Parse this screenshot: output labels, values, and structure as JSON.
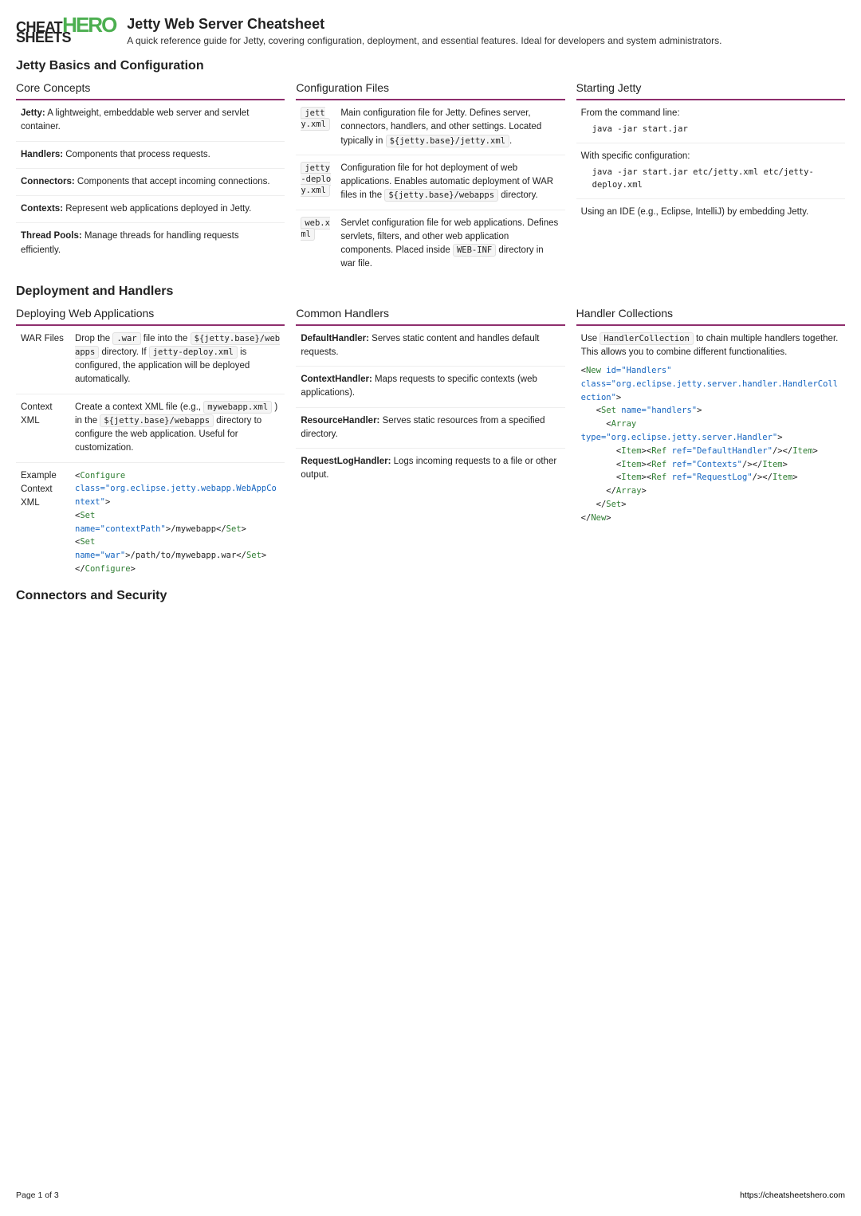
{
  "logo": {
    "line1": "CHEAT",
    "line2": "SHEETS",
    "hero": "HERO"
  },
  "title": "Jetty Web Server Cheatsheet",
  "subtitle": "A quick reference guide for Jetty, covering configuration, deployment, and essential features. Ideal for developers and system administrators.",
  "s1": {
    "heading": "Jetty Basics and Configuration",
    "core": {
      "title": "Core Concepts",
      "r1b": "Jetty:",
      "r1": " A lightweight, embeddable web server and servlet container.",
      "r2b": "Handlers:",
      "r2": " Components that process requests.",
      "r3b": "Connectors:",
      "r3": " Components that accept incoming connections.",
      "r4b": "Contexts:",
      "r4": " Represent web applications deployed in Jetty.",
      "r5b": "Thread Pools:",
      "r5": " Manage threads for handling requests efficiently."
    },
    "config": {
      "title": "Configuration Files",
      "r1k": "jetty.xml",
      "r1a": "Main configuration file for Jetty. Defines server, connectors, handlers, and other settings. Located typically in ",
      "r1c": "${jetty.base}/jetty.xml",
      "r1b": ".",
      "r2k": "jetty-deploy.xml",
      "r2a": "Configuration file for hot deployment of web applications. Enables automatic deployment of WAR files in the ",
      "r2c": "${jetty.base}/webapps",
      "r2b": " directory.",
      "r3k": "web.xml",
      "r3a": "Servlet configuration file for web applications. Defines servlets, filters, and other web application components. Placed inside ",
      "r3c": "WEB-INF",
      "r3b": " directory in war file."
    },
    "start": {
      "title": "Starting Jetty",
      "r1": "From the command line:",
      "r1c": "java -jar start.jar",
      "r2": "With specific configuration:",
      "r2c": "java -jar start.jar etc/jetty.xml etc/jetty-deploy.xml",
      "r3": "Using an IDE (e.g., Eclipse, IntelliJ) by embedding Jetty."
    }
  },
  "s2": {
    "heading": "Deployment and Handlers",
    "deploy": {
      "title": "Deploying Web Applications",
      "r1k": "WAR Files",
      "r1a": "Drop the ",
      "r1c1": ".war",
      "r1b": " file into the ",
      "r1c2": "${jetty.base}/webapps",
      "r1d": " directory. If ",
      "r1c3": "jetty-deploy.xml",
      "r1e": " is configured, the application will be deployed automatically.",
      "r2k": "Context XML",
      "r2a": "Create a context XML file (e.g., ",
      "r2c1": "mywebapp.xml",
      "r2b": " ) in the ",
      "r2c2": "${jetty.base}/webapps",
      "r2d": " directory to configure the web application. Useful for customization.",
      "r3k": "Example Context XML",
      "code": {
        "l1a": "<",
        "l1b": "Configure",
        "l2a": "class",
        "l2b": "=\"org.eclipse.jetty.webapp.WebAppContext\"",
        "l2c": ">",
        "l3a": "  <",
        "l3b": "Set",
        "l4a": "name",
        "l4b": "=\"contextPath\"",
        "l4c": ">/mywebapp</",
        "l4d": "Set",
        "l4e": ">",
        "l5a": "  <",
        "l5b": "Set",
        "l6a": "name",
        "l6b": "=\"war\"",
        "l6c": ">/path/to/mywebapp.war</",
        "l6d": "Set",
        "l6e": ">",
        "l7a": "</",
        "l7b": "Configure",
        "l7c": ">"
      }
    },
    "handlers": {
      "title": "Common Handlers",
      "r1b": "DefaultHandler:",
      "r1": " Serves static content and handles default requests.",
      "r2b": "ContextHandler:",
      "r2": " Maps requests to specific contexts (web applications).",
      "r3b": "ResourceHandler:",
      "r3": " Serves static resources from a specified directory.",
      "r4b": "RequestLogHandler:",
      "r4": " Logs incoming requests to a file or other output."
    },
    "coll": {
      "title": "Handler Collections",
      "intro_a": "Use ",
      "intro_c": "HandlerCollection",
      "intro_b": " to chain multiple handlers together. This allows you to combine different functionalities.",
      "code": {
        "l1": "<",
        "l1t": "New",
        "l1a": " id",
        "l1v": "=\"Handlers\"",
        "l2a": "class",
        "l2v": "=\"org.eclipse.jetty.server.handler.HandlerCollection\"",
        "l2c": ">",
        "l3": "  <",
        "l3t": "Set",
        "l3a": " name",
        "l3v": "=\"handlers\"",
        "l3c": ">",
        "l4": "    <",
        "l4t": "Array",
        "l5a": "type",
        "l5v": "=\"org.eclipse.jetty.server.Handler\"",
        "l5c": ">",
        "l6": "      <",
        "l6t": "Item",
        "l6b": "><",
        "l6r": "Ref",
        "l6ra": " ref",
        "l6rv": "=\"DefaultHandler\"",
        "l6c": "/></",
        "l6t2": "Item",
        "l6e": ">",
        "l7": "      <",
        "l7t": "Item",
        "l7b": "><",
        "l7r": "Ref",
        "l7ra": " ref",
        "l7rv": "=\"Contexts\"",
        "l7c": "/></",
        "l7t2": "Item",
        "l7e": ">",
        "l8": "      <",
        "l8t": "Item",
        "l8b": "><",
        "l8r": "Ref",
        "l8ra": " ref",
        "l8rv": "=\"RequestLog\"",
        "l8c": "/></",
        "l8t2": "Item",
        "l8e": ">",
        "l9": "    </",
        "l9t": "Array",
        "l9c": ">",
        "l10": "  </",
        "l10t": "Set",
        "l10c": ">",
        "l11": "</",
        "l11t": "New",
        "l11c": ">"
      }
    }
  },
  "s3": {
    "heading": "Connectors and Security"
  },
  "footer": {
    "page": "Page 1 of 3",
    "url": "https://cheatsheetshero.com"
  }
}
